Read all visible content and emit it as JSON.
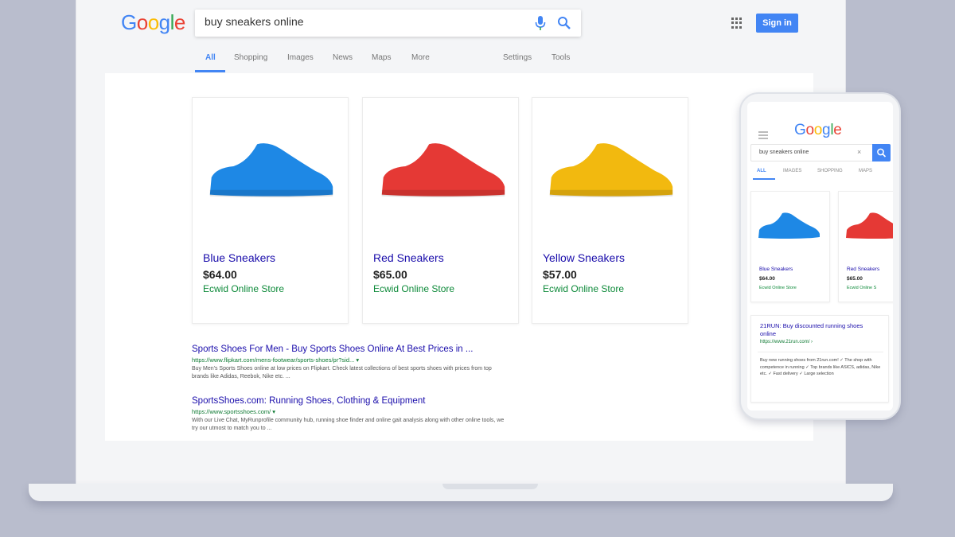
{
  "google_logo": [
    "G",
    "o",
    "o",
    "g",
    "l",
    "e"
  ],
  "search": {
    "query": "buy sneakers online",
    "mic_icon": "mic-icon",
    "search_icon": "search-icon"
  },
  "header": {
    "apps_icon": "apps-grid-icon",
    "signin_label": "Sign in"
  },
  "tabs": [
    "All",
    "Shopping",
    "Images",
    "News",
    "Maps",
    "More",
    "Settings",
    "Tools"
  ],
  "products": [
    {
      "title": "Blue Sneakers",
      "price": "$64.00",
      "store": "Ecwid Online Store",
      "color": "#1e88e5"
    },
    {
      "title": "Red Sneakers",
      "price": "$65.00",
      "store": "Ecwid Online Store",
      "color": "#e53935"
    },
    {
      "title": "Yellow Sneakers",
      "price": "$57.00",
      "store": "Ecwid Online Store",
      "color": "#f2b90f"
    }
  ],
  "results": [
    {
      "title": "Sports Shoes For Men - Buy Sports Shoes Online At Best Prices in ...",
      "url": "https://www.flipkart.com/mens-footwear/sports-shoes/pr?sid... ▾",
      "snippet": "Buy Men's Sports Shoes online at low prices on Flipkart. Check latest collections of best sports shoes with prices from top brands like Adidas, Reebok, Nike etc. ..."
    },
    {
      "title": "SportsShoes.com: Running Shoes, Clothing & Equipment",
      "url": "https://www.sportsshoes.com/ ▾",
      "snippet": "With our Live Chat, MyRunprofile community hub, running shoe finder and online gait analysis along with other online tools, we try our utmost to match you to ..."
    }
  ],
  "phone": {
    "logo": [
      "G",
      "o",
      "o",
      "g",
      "l",
      "e"
    ],
    "search_query": "buy sneakers online",
    "clear_icon": "×",
    "tabs": [
      "ALL",
      "IMAGES",
      "SHOPPING",
      "MAPS"
    ],
    "products": [
      {
        "title": "Blue Sneakers",
        "price": "$64.00",
        "store": "Ecwid Online Store"
      },
      {
        "title": "Red Sneakers",
        "price": "$65.00",
        "store": "Ecwid Online S"
      }
    ],
    "result": {
      "title": "21RUN: Buy discounted running shoes online",
      "url": "https://www.21run.com/ ›",
      "snippet": "Buy new running shoes from 21run.com! ✓ The shop with competence in running ✓ Top brands like ASICS, adidas, Nike etc. ✓ Fast delivery ✓ Large selection"
    }
  }
}
